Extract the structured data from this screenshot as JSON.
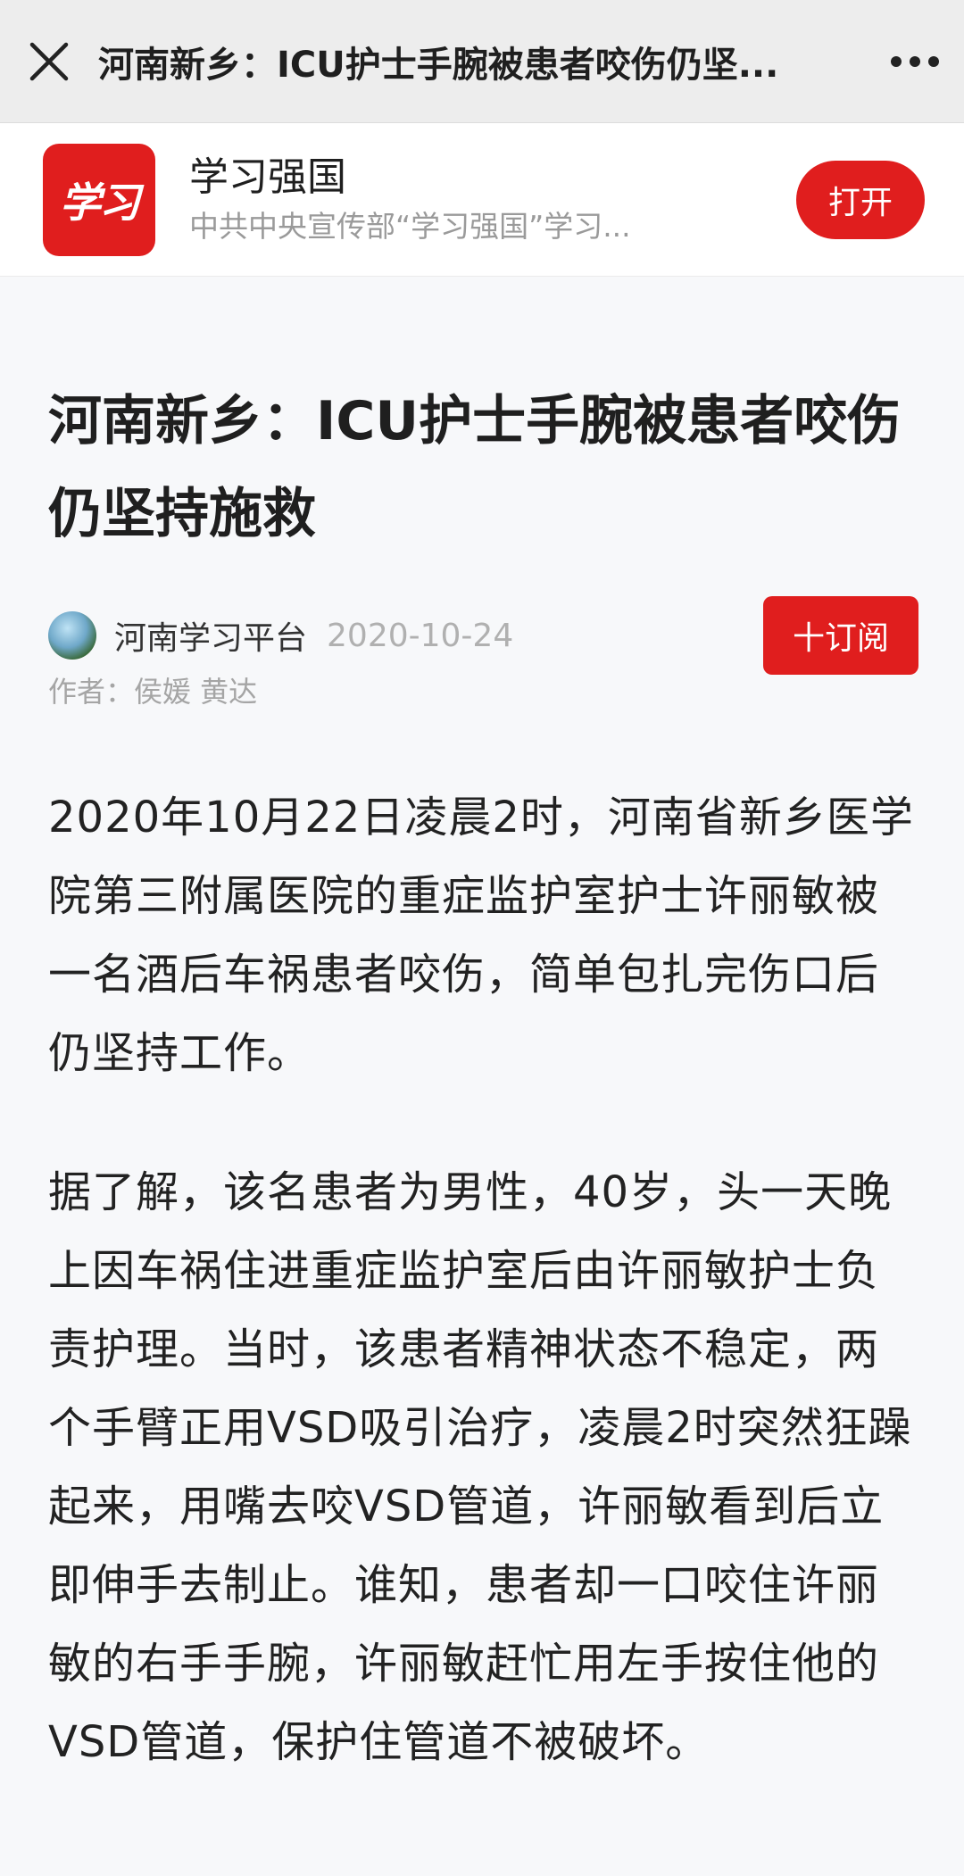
{
  "topbar": {
    "title": "河南新乡：ICU护士手腕被患者咬伤仍坚...",
    "close_icon": "close-icon",
    "more_icon": "more-dots-icon"
  },
  "app_banner": {
    "logo_text": "学习",
    "name": "学习强国",
    "description": "中共中央宣传部“学习强国”学习...",
    "open_label": "打开"
  },
  "article": {
    "title": "河南新乡：ICU护士手腕被患者咬伤仍坚持施救",
    "source": "河南学习平台",
    "date": "2020-10-24",
    "subscribe_label": "十订阅",
    "author": "作者：侯媛 黄达",
    "paragraphs": [
      "2020年10月22日凌晨2时，河南省新乡医学院第三附属医院的重症监护室护士许丽敏被一名酒后车祸患者咬伤，简单包扎完伤口后仍坚持工作。",
      "据了解，该名患者为男性，40岁，头一天晚上因车祸住进重症监护室后由许丽敏护士负责护理。当时，该患者精神状态不稳定，两个手臂正用VSD吸引治疗，凌晨2时突然狂躁起来，用嘴去咬VSD管道，许丽敏看到后立即伸手去制止。谁知，患者却一口咬住许丽敏的右手手腕，许丽敏赶忙用左手按住他的VSD管道，保护住管道不被破坏。"
    ]
  },
  "colors": {
    "accent": "#e01e1e",
    "topbar_bg": "#ededed",
    "page_bg": "#f7f8fa"
  }
}
